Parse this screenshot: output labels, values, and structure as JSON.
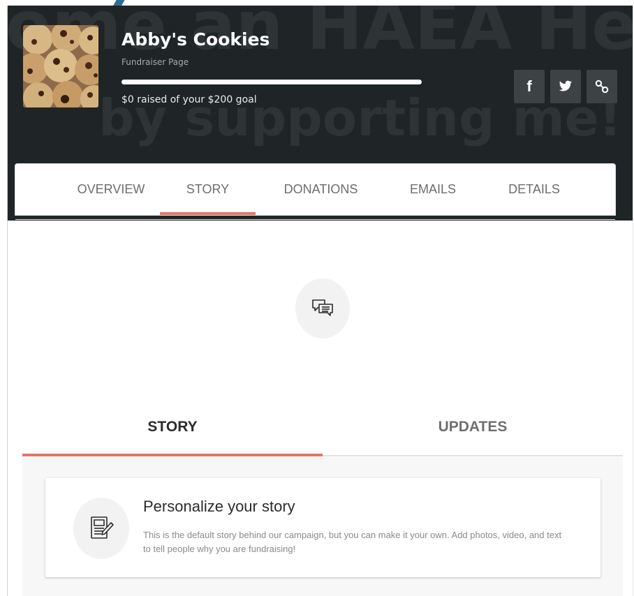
{
  "header": {
    "hero_watermark_line1": "come an HAEA He",
    "hero_watermark_line2": "by supporting me!",
    "title": "Abby's Cookies",
    "subtitle": "Fundraiser Page",
    "progress_fraction": 0,
    "raised_text": "$0 raised of your $200 goal",
    "share_buttons": [
      {
        "icon": "facebook-icon",
        "glyph": "f"
      },
      {
        "icon": "twitter-icon"
      },
      {
        "icon": "link-icon"
      }
    ]
  },
  "nav": {
    "tabs": [
      "OVERVIEW",
      "STORY",
      "DONATIONS",
      "EMAILS",
      "DETAILS"
    ],
    "active": "STORY"
  },
  "story_section": {
    "icon": "chat-bubbles-icon",
    "subtabs": [
      "STORY",
      "UPDATES"
    ],
    "active_subtab": "STORY"
  },
  "card": {
    "icon": "document-edit-icon",
    "heading": "Personalize your story",
    "text": "This is the default story behind our campaign, but you can make it your own. Add photos, video, and text to tell people why you are fundraising!"
  },
  "colors": {
    "header_bg": "#1f2427",
    "accent": "#e47765",
    "share_btn_bg": "#3d4245"
  }
}
